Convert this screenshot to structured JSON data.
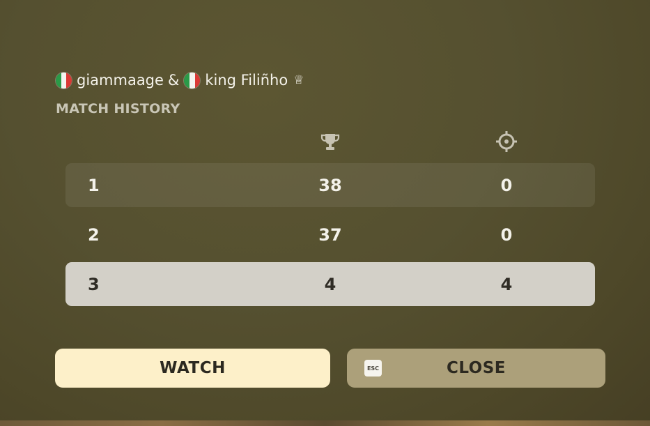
{
  "players": {
    "player1": {
      "flag": "italy-flag",
      "name": "giammaage"
    },
    "separator": "&",
    "player2": {
      "flag": "italy-flag",
      "name": "king Filiñho",
      "badge": "♕"
    }
  },
  "section_title": "MATCH HISTORY",
  "columns": [
    {
      "icon": "trophy-icon"
    },
    {
      "icon": "crosshair-icon"
    }
  ],
  "rows": [
    {
      "index": "1",
      "trophies": "38",
      "kills": "0",
      "style": "dim-highlight"
    },
    {
      "index": "2",
      "trophies": "37",
      "kills": "0",
      "style": "plain"
    },
    {
      "index": "3",
      "trophies": "4",
      "kills": "4",
      "style": "selected"
    }
  ],
  "buttons": {
    "watch_label": "WATCH",
    "close_label": "CLOSE",
    "close_key_hint": "ESC"
  },
  "colors": {
    "background": "#555030",
    "watch_button": "#fdf0c9",
    "close_button": "#aca07a",
    "selected_row": "#d3d0c8"
  }
}
